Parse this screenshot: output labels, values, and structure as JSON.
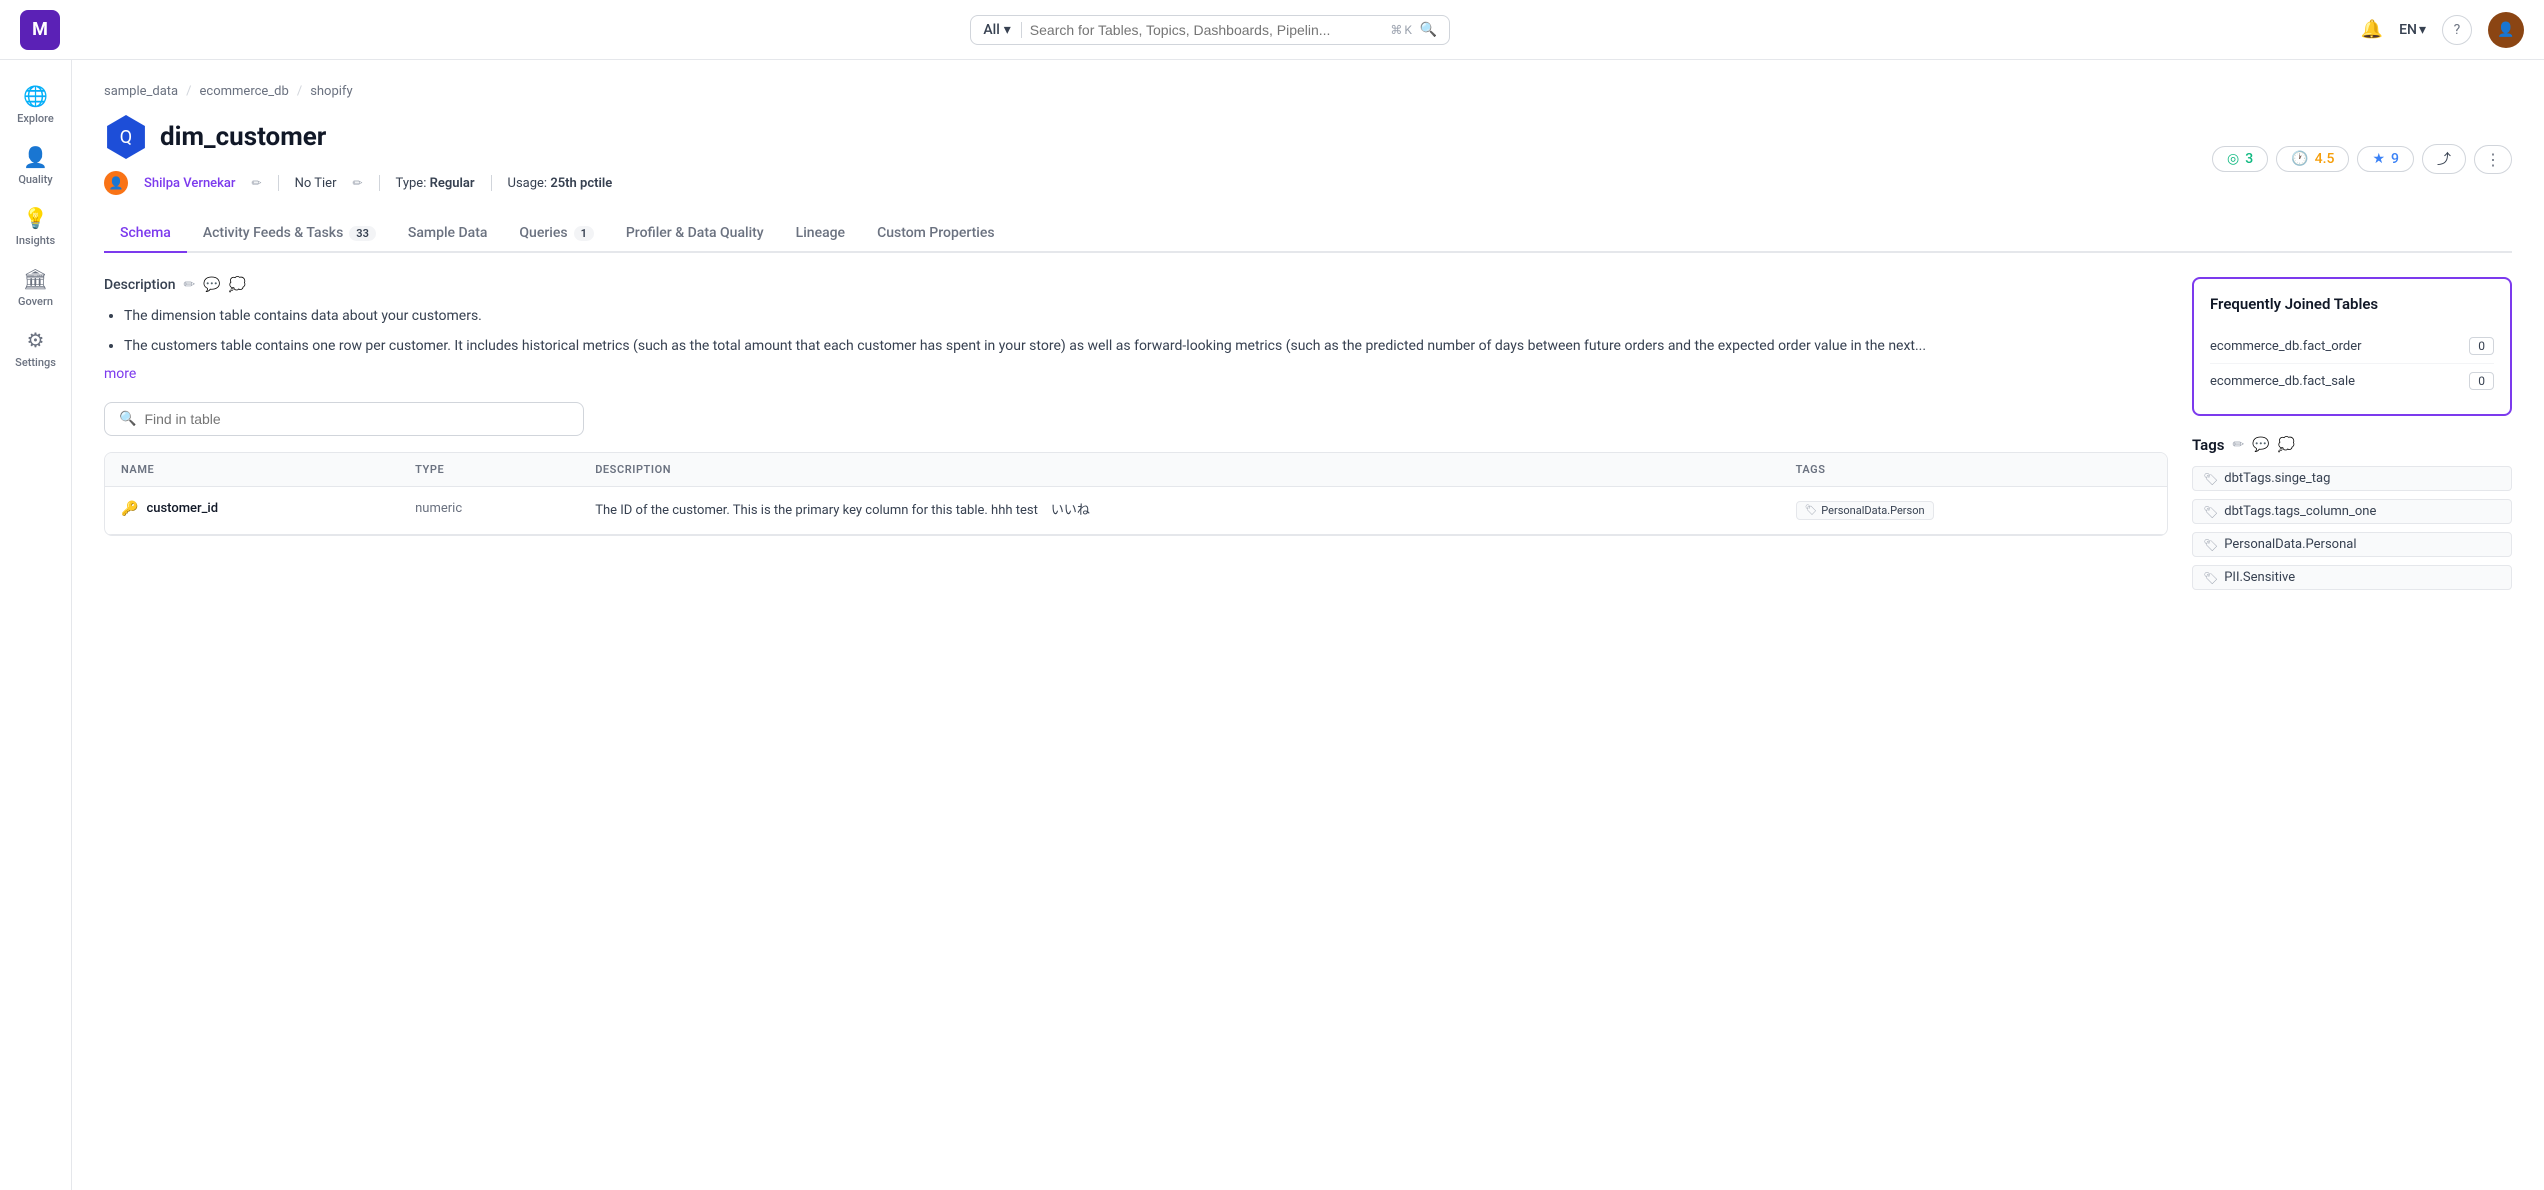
{
  "app": {
    "logo": "M"
  },
  "topbar": {
    "search": {
      "filter": "All",
      "placeholder": "Search for Tables, Topics, Dashboards, Pipelin...",
      "kbd1": "⌘",
      "kbd2": "K"
    },
    "lang": "EN",
    "help_icon": "?",
    "bell_icon": "🔔"
  },
  "breadcrumb": {
    "items": [
      "sample_data",
      "ecommerce_db",
      "shopify"
    ]
  },
  "entity": {
    "title": "dim_customer",
    "owner": "Shilpa Vernekar",
    "tier": "No Tier",
    "type_label": "Type:",
    "type_value": "Regular",
    "usage_label": "Usage:",
    "usage_value": "25th pctile"
  },
  "stats": {
    "health": "3",
    "rating": "4.5",
    "stars": "9",
    "health_icon": "◎",
    "rating_icon": "🕐",
    "star_icon": "★"
  },
  "tabs": [
    {
      "label": "Schema",
      "active": true,
      "badge": null
    },
    {
      "label": "Activity Feeds & Tasks",
      "active": false,
      "badge": "33"
    },
    {
      "label": "Sample Data",
      "active": false,
      "badge": null
    },
    {
      "label": "Queries",
      "active": false,
      "badge": "1"
    },
    {
      "label": "Profiler & Data Quality",
      "active": false,
      "badge": null
    },
    {
      "label": "Lineage",
      "active": false,
      "badge": null
    },
    {
      "label": "Custom Properties",
      "active": false,
      "badge": null
    }
  ],
  "description": {
    "label": "Description",
    "bullets": [
      "The dimension table contains data about your customers.",
      "The customers table contains one row per customer. It includes historical metrics (such as the total amount that each customer has spent in your store) as well as forward-looking metrics (such as the predicted number of days between future orders and the expected order value in the next..."
    ],
    "more_link": "more"
  },
  "table_search": {
    "placeholder": "Find in table"
  },
  "schema_columns": {
    "headers": [
      "NAME",
      "TYPE",
      "DESCRIPTION",
      "TAGS"
    ],
    "rows": [
      {
        "name": "customer_id",
        "icon": "🔑",
        "type": "numeric",
        "description": "The ID of the customer. This is the primary key column for this table. hhh test　いいね",
        "tags": [
          "PersonalData.Person"
        ]
      }
    ]
  },
  "frequently_joined": {
    "title": "Frequently Joined Tables",
    "items": [
      {
        "name": "ecommerce_db.fact_order",
        "count": "0"
      },
      {
        "name": "ecommerce_db.fact_sale",
        "count": "0"
      }
    ]
  },
  "tags_section": {
    "title": "Tags",
    "items": [
      "dbtTags.singe_tag",
      "dbtTags.tags_column_one",
      "PersonalData.Personal",
      "PII.Sensitive"
    ]
  },
  "sidebar": {
    "items": [
      {
        "label": "Explore",
        "icon": "🌐"
      },
      {
        "label": "Quality",
        "icon": "👤"
      },
      {
        "label": "Insights",
        "icon": "💡"
      },
      {
        "label": "Govern",
        "icon": "🏛"
      },
      {
        "label": "Settings",
        "icon": "⚙"
      }
    ]
  }
}
